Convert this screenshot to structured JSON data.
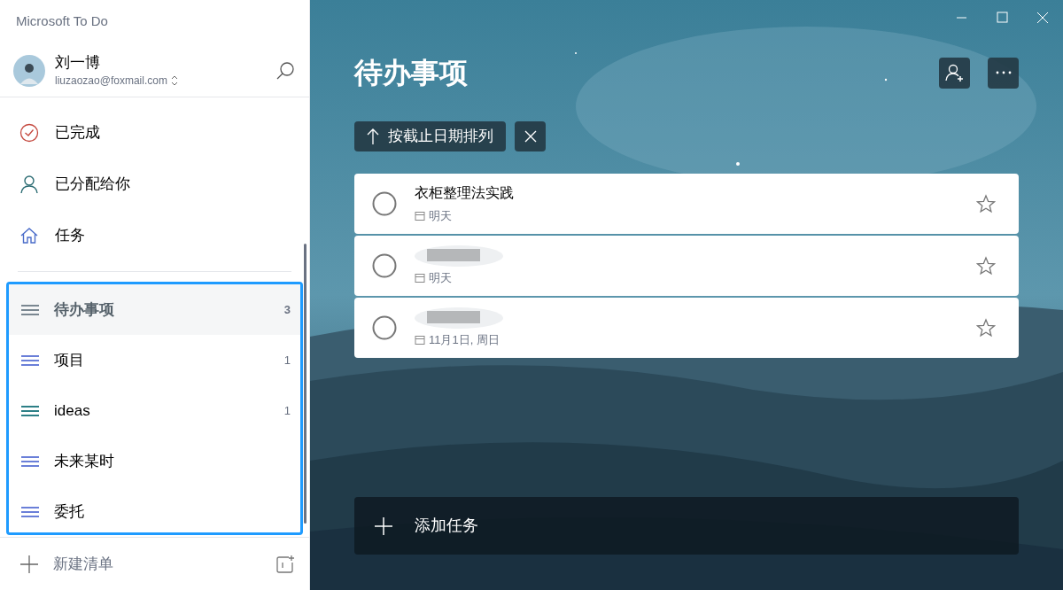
{
  "app_title": "Microsoft To Do",
  "account": {
    "name": "刘一博",
    "email": "liuzaozao@foxmail.com"
  },
  "nav": [
    {
      "kind": "completed",
      "label": "已完成",
      "color": "#c4473d"
    },
    {
      "kind": "assigned",
      "label": "已分配给你",
      "color": "#2a6b72"
    },
    {
      "kind": "tasks",
      "label": "任务",
      "color": "#4a6cc9"
    }
  ],
  "lists": [
    {
      "label": "待办事项",
      "count": "3",
      "selected": true,
      "color": "#7a8791"
    },
    {
      "label": "项目",
      "count": "1",
      "selected": false,
      "color": "#6a7fd8"
    },
    {
      "label": "ideas",
      "count": "1",
      "selected": false,
      "color": "#2d7f86"
    },
    {
      "label": "未来某时",
      "selected": false,
      "color": "#6a7fd8"
    },
    {
      "label": "委托",
      "selected": false,
      "color": "#6a7fd8"
    }
  ],
  "new_list": {
    "label": "新建清单"
  },
  "main": {
    "title": "待办事项",
    "sort": {
      "label": "按截止日期排列"
    },
    "tasks": [
      {
        "title": "衣柜整理法实践",
        "due": "明天",
        "completed": false,
        "starred": false
      },
      {
        "redacted": true,
        "due": "明天",
        "completed": false,
        "starred": false
      },
      {
        "redacted": true,
        "due": "11月1日, 周日",
        "completed": false,
        "starred": false
      }
    ],
    "add_task": {
      "label": "添加任务"
    }
  }
}
